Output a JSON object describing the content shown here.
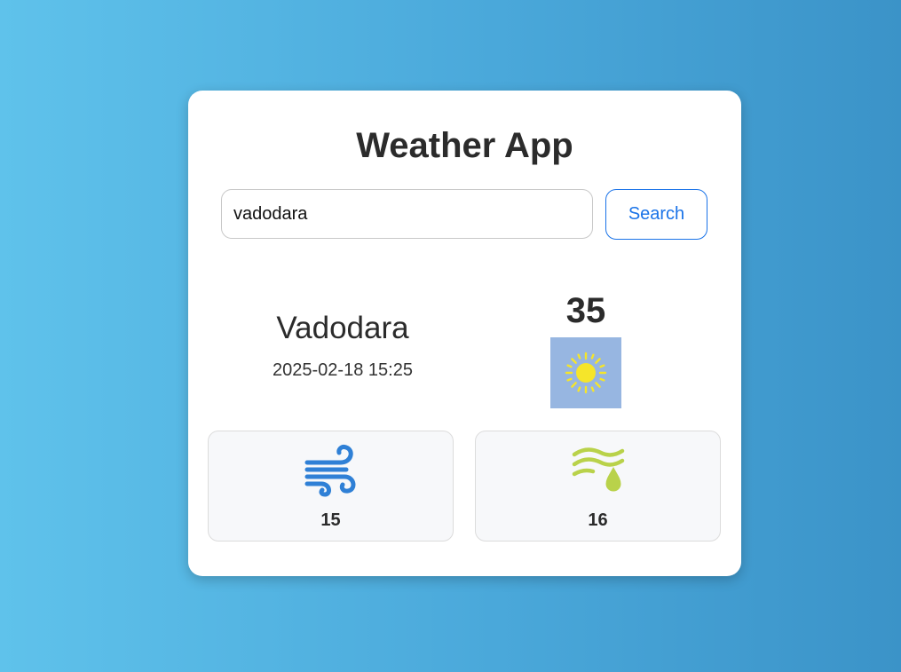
{
  "app": {
    "title": "Weather App"
  },
  "search": {
    "value": "vadodara",
    "button_label": "Search"
  },
  "current": {
    "city": "Vadodara",
    "datetime": "2025-02-18 15:25",
    "temperature": "35",
    "condition_icon": "sun-icon"
  },
  "metrics": [
    {
      "icon": "wind-icon",
      "value": "15"
    },
    {
      "icon": "humidity-icon",
      "value": "16"
    }
  ],
  "colors": {
    "accent": "#1a73e8",
    "sun": "#f5e52a",
    "sun_tile_bg": "#97b6e1",
    "wind_icon": "#2f80d6",
    "humidity_icon": "#b9d24a"
  }
}
